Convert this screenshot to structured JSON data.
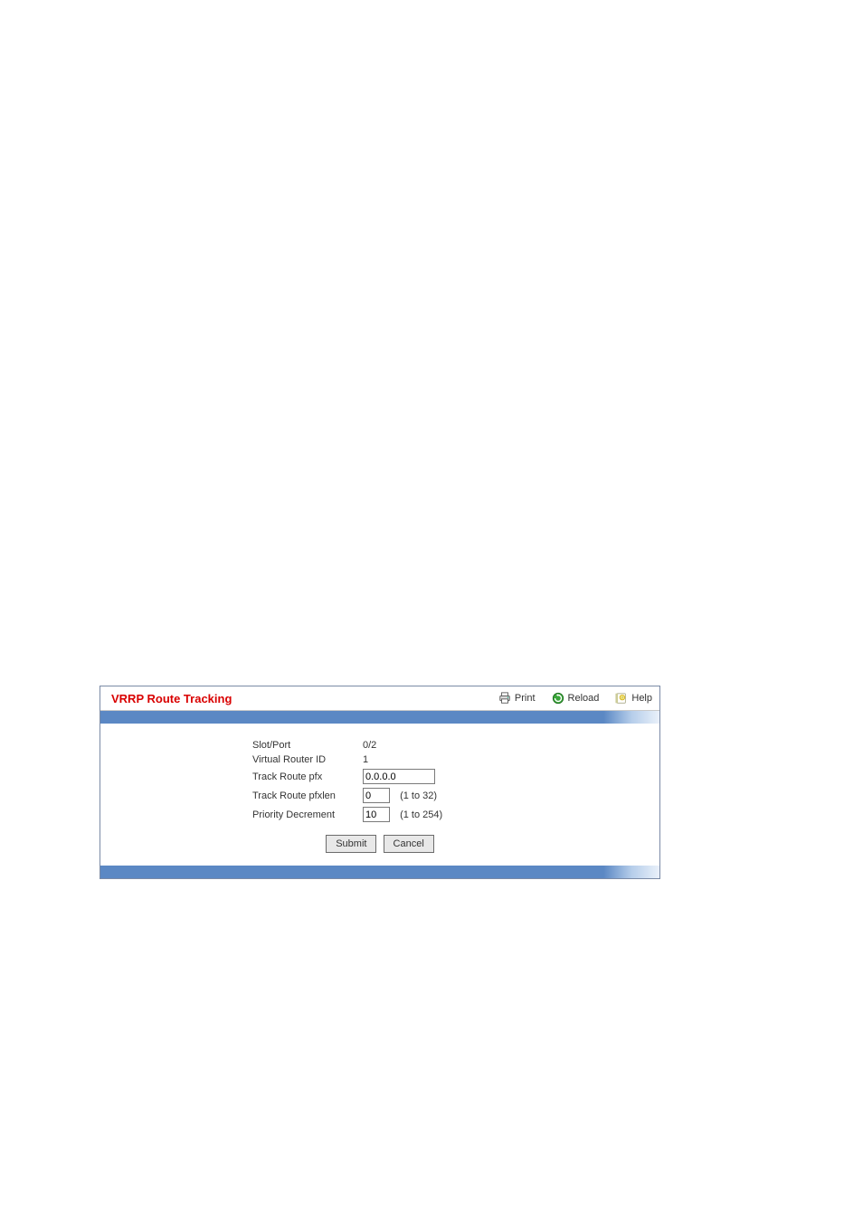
{
  "panel": {
    "title": "VRRP Route Tracking",
    "actions": {
      "print": "Print",
      "reload": "Reload",
      "help": "Help"
    }
  },
  "form": {
    "fields": {
      "slot_port": {
        "label": "Slot/Port",
        "value": "0/2"
      },
      "virtual_router_id": {
        "label": "Virtual Router ID",
        "value": "1"
      },
      "track_route_pfx": {
        "label": "Track Route pfx",
        "value": "0.0.0.0"
      },
      "track_route_pfxlen": {
        "label": "Track Route pfxlen",
        "value": "0",
        "hint": "(1 to 32)"
      },
      "priority_decrement": {
        "label": "Priority Decrement",
        "value": "10",
        "hint": "(1 to 254)"
      }
    },
    "buttons": {
      "submit": "Submit",
      "cancel": "Cancel"
    }
  }
}
